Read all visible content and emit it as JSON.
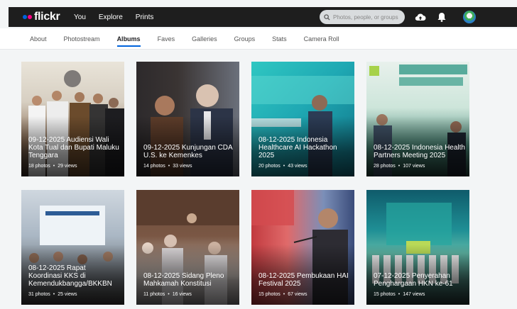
{
  "header": {
    "logo": "flickr",
    "nav": [
      "You",
      "Explore",
      "Prints"
    ],
    "search_placeholder": "Photos, people, or groups",
    "icons": [
      "upload-cloud-icon",
      "notification-bell-icon"
    ]
  },
  "subnav": {
    "active": "Albums",
    "tabs": [
      "About",
      "Photostream",
      "Albums",
      "Faves",
      "Galleries",
      "Groups",
      "Stats",
      "Camera Roll"
    ]
  },
  "albums": [
    {
      "title": "09-12-2025 Audiensi Wali Kota Tual dan Bupati Maluku Tenggara",
      "photos": "18 photos",
      "views": "29 views"
    },
    {
      "title": "09-12-2025 Kunjungan CDA U.S. ke Kemenkes",
      "photos": "14 photos",
      "views": "33 views"
    },
    {
      "title": "08-12-2025 Indonesia Healthcare AI Hackathon 2025",
      "photos": "20 photos",
      "views": "43 views"
    },
    {
      "title": "08-12-2025 Indonesia Health Partners Meeting 2025",
      "photos": "28 photos",
      "views": "107 views"
    },
    {
      "title": "08-12-2025 Rapat Koordinasi KKS di Kemendukbangga/BKKBN",
      "photos": "31 photos",
      "views": "25 views"
    },
    {
      "title": "08-12-2025 Sidang Pleno Mahkamah Konstitusi",
      "photos": "11 photos",
      "views": "16 views"
    },
    {
      "title": "08-12-2025 Pembukaan HAI Festival 2025",
      "photos": "15 photos",
      "views": "67 views"
    },
    {
      "title": "07-12-2025 Penyerahan Penghargaan HKN ke-61",
      "photos": "15 photos",
      "views": "147 views"
    }
  ]
}
